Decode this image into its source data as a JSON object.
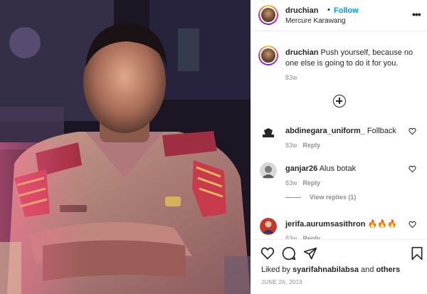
{
  "post": {
    "username": "druchian",
    "follow_label": "Follow",
    "dot": "•",
    "location": "Mercure Karawang",
    "more_icon": "more-horizontal-icon",
    "more_glyph": "•••"
  },
  "caption": {
    "username": "druchian",
    "text": "Push yourself, because no one else is going to do it for you.",
    "time": "83w"
  },
  "load_more_icon": "plus-circle-icon",
  "comments": [
    {
      "username": "abdinegara_uniform_",
      "text": "Follback",
      "time": "83w",
      "reply_label": "Reply"
    },
    {
      "username": "ganjar26",
      "text": "Alus botak",
      "time": "83w",
      "reply_label": "Reply",
      "view_replies": "View replies (1)"
    },
    {
      "username": "jerifa.aurumsasithron",
      "text": "🔥🔥🔥",
      "time": "83w",
      "reply_label": "Reply"
    }
  ],
  "actions": {
    "icons": [
      "heart-icon",
      "comment-icon",
      "share-icon",
      "bookmark-icon"
    ]
  },
  "likes": {
    "prefix": "Liked by ",
    "user": "syarifahnabilabsa",
    "middle": " and ",
    "others": "others"
  },
  "date": "JUNE 26, 2019",
  "colors": {
    "link": "#0095f6",
    "text": "#262626",
    "muted": "#8e8e8e",
    "border": "#efefef"
  }
}
